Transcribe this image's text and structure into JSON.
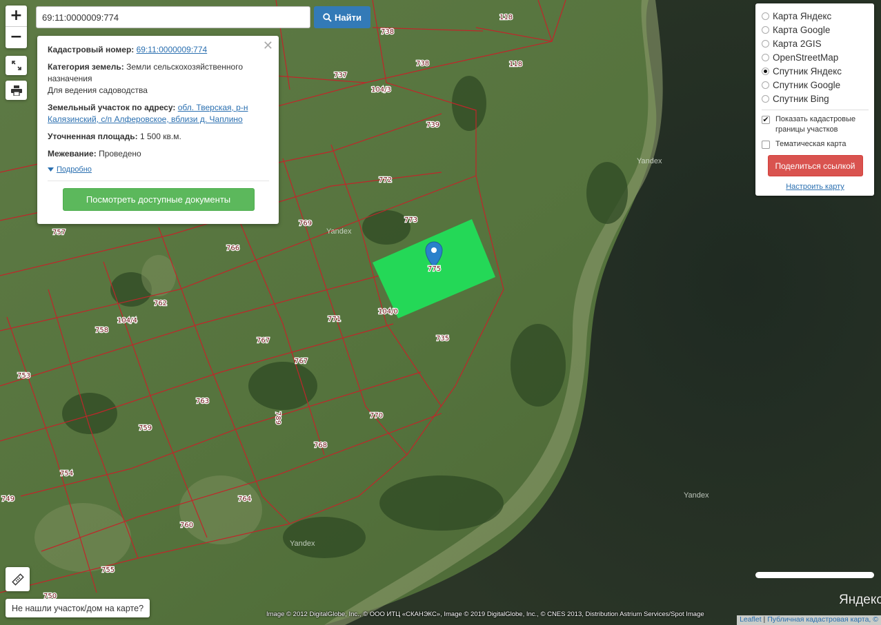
{
  "search": {
    "value": "69:11:0000009:774",
    "button_label": "Найти"
  },
  "popup": {
    "cadastral_label": "Кадастровый номер:",
    "cadastral_value": "69:11:0000009:774",
    "category_label": "Категория земель:",
    "category_value": "Земли сельскохозяйственного назначения",
    "use_value": "Для ведения садоводства",
    "address_label": "Земельный участок по адресу:",
    "address_value": "обл. Тверская, р-н Калязинский, с/п Алферовское, вблизи д. Чаплино",
    "area_label": "Уточненная площадь:",
    "area_value": "1 500 кв.м.",
    "survey_label": "Межевание:",
    "survey_value": "Проведено",
    "more_label": "Подробно",
    "docs_button": "Посмотреть доступные документы"
  },
  "layers": {
    "options": [
      {
        "label": "Карта Яндекс",
        "selected": false
      },
      {
        "label": "Карта Google",
        "selected": false
      },
      {
        "label": "Карта 2GIS",
        "selected": false
      },
      {
        "label": "OpenStreetMap",
        "selected": false
      },
      {
        "label": "Спутник Яндекс",
        "selected": true
      },
      {
        "label": "Спутник Google",
        "selected": false
      },
      {
        "label": "Спутник Bing",
        "selected": false
      }
    ],
    "show_boundaries": "Показать кадастровые границы участков",
    "show_boundaries_checked": true,
    "thematic": "Тематическая карта",
    "thematic_checked": false,
    "share_button": "Поделиться ссылкой",
    "tune_link": "Настроить карту"
  },
  "map": {
    "parcel_labels": [
      "118",
      "738",
      "738",
      "118",
      "737",
      "104/3",
      "739",
      "772",
      "773",
      "769",
      "766",
      "757",
      "762",
      "104/4",
      "758",
      "771",
      "104/0",
      "735",
      "767",
      "767",
      "753",
      "763",
      "789",
      "759",
      "770",
      "768",
      "754",
      "764",
      "749",
      "760",
      "755",
      "750",
      "775"
    ],
    "watermark": "Yandex",
    "selected_parcel_color": "#1fe35a",
    "boundary_color": "#c0262a"
  },
  "controls": {
    "zoom_in": "+",
    "zoom_out": "−",
    "not_found": "Не нашли участок/дом на карте?"
  },
  "footer": {
    "copyright": "Image © 2012 DigitalGlobe, Inc., © ООО ИТЦ «СКАНЭКС», Image © 2019 DigitalGlobe, Inc., © CNES 2013, Distribution Astrium Services/Spot Image",
    "leaflet": "Leaflet",
    "pkk": "Публичная кадастровая карта, ©",
    "yandex_logo": "Яндекс"
  }
}
